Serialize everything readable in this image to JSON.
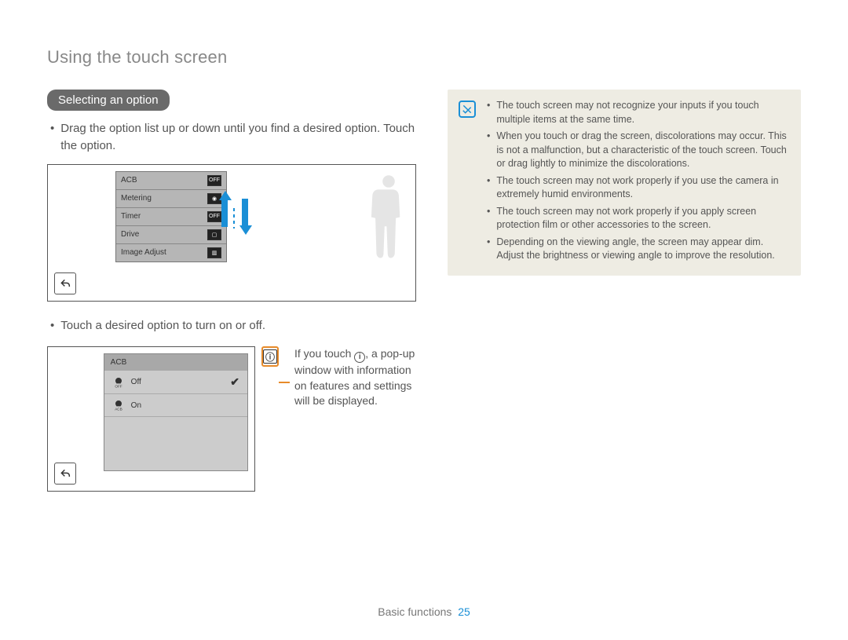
{
  "page_title": "Using the touch screen",
  "section_heading": "Selecting an option",
  "left": {
    "intro": "Drag the option list up or down until you find a desired option. Touch the option.",
    "fig1": {
      "items": [
        "ACB",
        "Metering",
        "Timer",
        "Drive",
        "Image Adjust"
      ]
    },
    "intro2": "Touch a desired option to turn on or off.",
    "fig2": {
      "header": "ACB",
      "off": "Off",
      "on": "On"
    },
    "info_caption_1": "If you touch ",
    "info_caption_2": ", a pop-up window with information on features and settings will be displayed."
  },
  "note": {
    "items": [
      "The touch screen may not recognize your inputs if you touch multiple items at the same time.",
      "When you touch or drag the screen, discolorations may occur. This is not a malfunction, but a characteristic of the touch screen. Touch or drag lightly to minimize the discolorations.",
      "The touch screen may not work properly if you use the camera in extremely humid environments.",
      "The touch screen may not work properly if you apply screen protection film or other accessories to the screen.",
      "Depending on the viewing angle, the screen may appear dim. Adjust the brightness or viewing angle to improve the resolution."
    ]
  },
  "footer": {
    "label": "Basic functions",
    "page": "25"
  }
}
